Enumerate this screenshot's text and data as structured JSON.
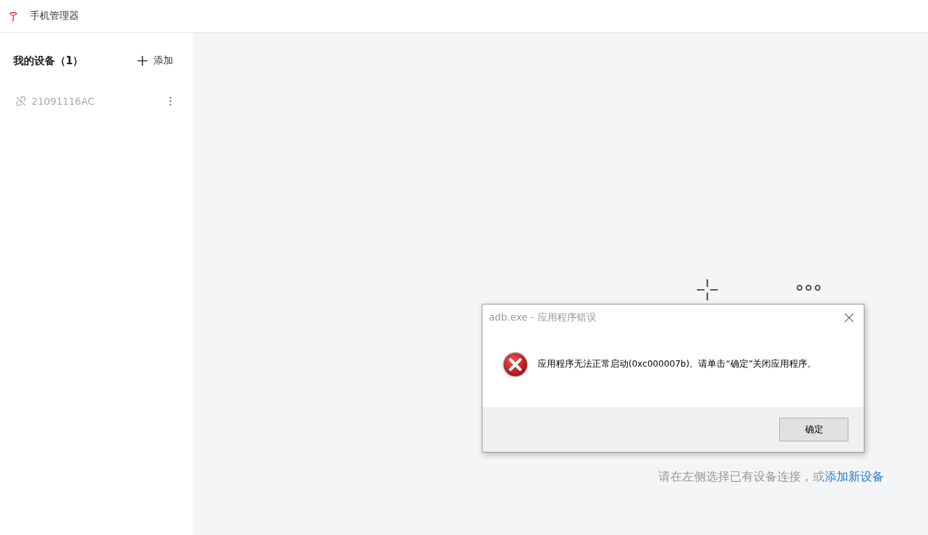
{
  "app": {
    "title": "手机管理器"
  },
  "sidebar": {
    "heading": "我的设备（1）",
    "add_button": "添加",
    "devices": [
      {
        "name": "21091116AC",
        "connected": false
      }
    ]
  },
  "main": {
    "hint": "请在左侧选择已有设备连接，或",
    "hint_link": "添加新设备"
  },
  "dialog": {
    "title": "adb.exe - 应用程序错误",
    "message": "应用程序无法正常启动(0xc000007b)。请单击“确定”关闭应用程序。",
    "buttons": [
      "确定"
    ]
  }
}
